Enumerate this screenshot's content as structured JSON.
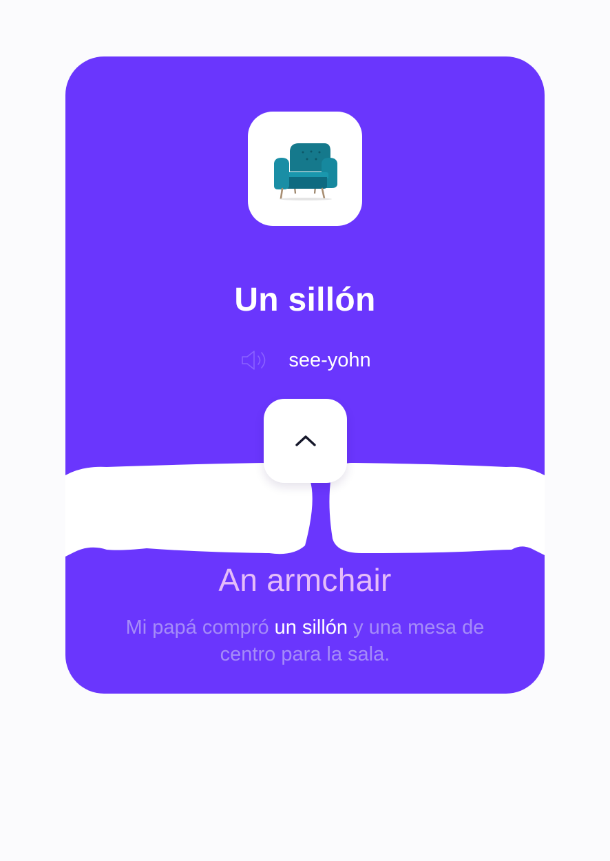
{
  "card": {
    "word": "Un sillón",
    "pronunciation": "see-yohn",
    "translation": "An armchair",
    "sentence": {
      "before": "Mi papá compró ",
      "highlight": "un sillón",
      "after": " y una mesa de centro para la sala."
    }
  },
  "icons": {
    "image": "armchair-image",
    "speaker": "speaker-icon",
    "reveal": "chevron-up-icon"
  },
  "colors": {
    "card_background": "#6a36fd",
    "page_background": "#fbfbfd",
    "translation_text": "#e5bdf9",
    "sentence_text": "#a58cf8",
    "highlight_text": "#ffffff"
  }
}
